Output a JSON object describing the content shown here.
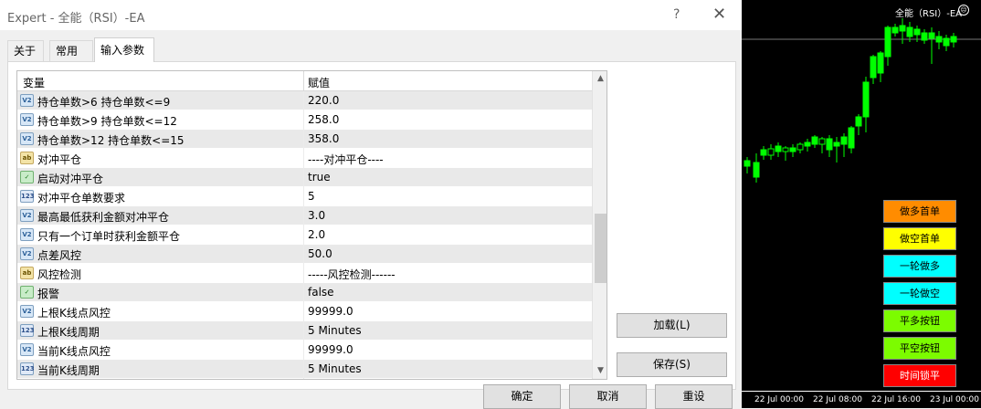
{
  "window": {
    "title": "Expert - 全能（RSI）-EA",
    "help_label": "?",
    "close_label": "✕"
  },
  "tabs": [
    {
      "label": "关于",
      "active": false
    },
    {
      "label": "常用",
      "active": false
    },
    {
      "label": "输入参数",
      "active": true
    }
  ],
  "table": {
    "col_variable": "变量",
    "col_value": "赋值",
    "rows": [
      {
        "icon": "v2",
        "icon_text": "V2",
        "name": "持仓单数>6   持仓单数<=9",
        "value": "220.0"
      },
      {
        "icon": "v2",
        "icon_text": "V2",
        "name": "持仓单数>9   持仓单数<=12",
        "value": "258.0"
      },
      {
        "icon": "v2",
        "icon_text": "V2",
        "name": "持仓单数>12  持仓单数<=15",
        "value": "358.0"
      },
      {
        "icon": "ab",
        "icon_text": "ab",
        "name": "对冲平仓",
        "value": "----对冲平仓----"
      },
      {
        "icon": "bool",
        "icon_text": "✓",
        "name": "启动对冲平仓",
        "value": "true"
      },
      {
        "icon": "n123",
        "icon_text": "123",
        "name": "对冲平仓单数要求",
        "value": "5"
      },
      {
        "icon": "v2",
        "icon_text": "V2",
        "name": "最高最低获利金额对冲平仓",
        "value": "3.0"
      },
      {
        "icon": "v2",
        "icon_text": "V2",
        "name": "只有一个订单时获利金额平仓",
        "value": "2.0"
      },
      {
        "icon": "v2",
        "icon_text": "V2",
        "name": "点差风控",
        "value": "50.0"
      },
      {
        "icon": "ab",
        "icon_text": "ab",
        "name": "风控检测",
        "value": "-----风控检测------"
      },
      {
        "icon": "bool",
        "icon_text": "✓",
        "name": "报警",
        "value": "false"
      },
      {
        "icon": "v2",
        "icon_text": "V2",
        "name": "上根K线点风控",
        "value": "99999.0"
      },
      {
        "icon": "n123",
        "icon_text": "123",
        "name": "上根K线周期",
        "value": "5 Minutes"
      },
      {
        "icon": "v2",
        "icon_text": "V2",
        "name": "当前K线点风控",
        "value": "99999.0"
      },
      {
        "icon": "n123",
        "icon_text": "123",
        "name": "当前K线周期",
        "value": "5 Minutes"
      }
    ]
  },
  "buttons": {
    "load": "加载(L)",
    "save": "保存(S)",
    "ok": "确定",
    "cancel": "取消",
    "reset": "重设"
  },
  "chart": {
    "title": "全能（RSI）-EA",
    "face_icon": "☹",
    "buttons": [
      {
        "label": "做多首单",
        "color": "#ff8c00",
        "text_color": "#000000"
      },
      {
        "label": "做空首单",
        "color": "#ffff00",
        "text_color": "#000000"
      },
      {
        "label": "一轮做多",
        "color": "#00ffff",
        "text_color": "#000000"
      },
      {
        "label": "一轮做空",
        "color": "#00ffff",
        "text_color": "#000000"
      },
      {
        "label": "平多按钮",
        "color": "#7cfc00",
        "text_color": "#000000"
      },
      {
        "label": "平空按钮",
        "color": "#7cfc00",
        "text_color": "#000000"
      },
      {
        "label": "时间锁平",
        "color": "#ff0000",
        "text_color": "#ffffff"
      }
    ],
    "x_labels": [
      "22 Jul 00:00",
      "22 Jul 08:00",
      "22 Jul 16:00",
      "23 Jul 00:00"
    ],
    "candle_color": "#00ff00"
  }
}
